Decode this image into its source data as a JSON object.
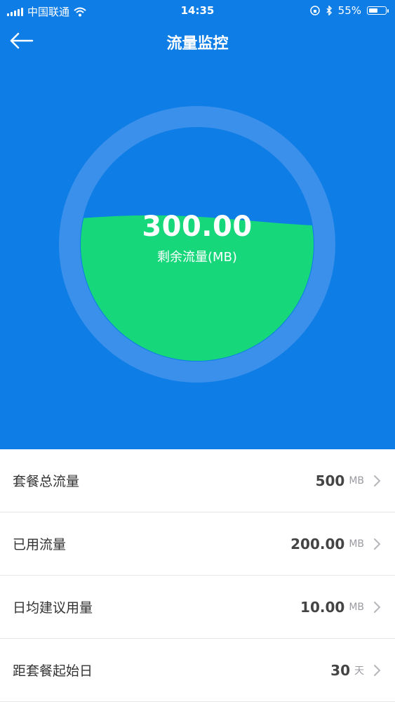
{
  "status_bar": {
    "carrier": "中国联通",
    "time": "14:35",
    "battery_percent": "55%",
    "battery_level": 0.55
  },
  "nav": {
    "title": "流量监控"
  },
  "gauge": {
    "value": "300.00",
    "label": "剩余流量(MB)",
    "fill_fraction": 0.6,
    "colors": {
      "background": "#0e7de6",
      "ring": "#3a90ea",
      "fill": "#16d77a"
    }
  },
  "rows": [
    {
      "label": "套餐总流量",
      "value": "500",
      "unit": "MB"
    },
    {
      "label": "已用流量",
      "value": "200.00",
      "unit": "MB"
    },
    {
      "label": "日均建议用量",
      "value": "10.00",
      "unit": "MB"
    },
    {
      "label": "距套餐起始日",
      "value": "30",
      "unit": "天"
    }
  ],
  "icons": {
    "back": "arrow-left-icon",
    "chevron": "chevron-right-icon",
    "wifi": "wifi-icon",
    "bluetooth": "bluetooth-icon",
    "lock": "orientation-lock-icon"
  }
}
